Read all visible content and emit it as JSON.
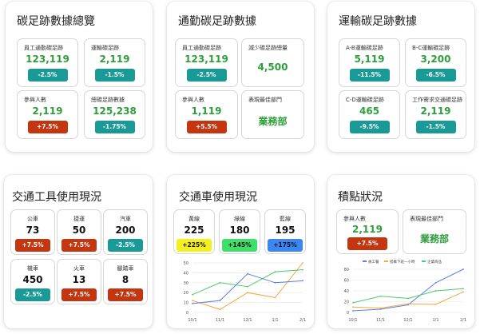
{
  "cards": {
    "overview": {
      "title": "碳足跡數據總覽",
      "cells": [
        {
          "label": "員工通勤碳足跡",
          "value": "123,119",
          "badge": "-2.5%",
          "badge_color": "teal"
        },
        {
          "label": "運輸碳足跡",
          "value": "2,119",
          "badge": "-1.5%",
          "badge_color": "teal"
        },
        {
          "label": "參與人數",
          "value": "2,119",
          "badge": "+7.5%",
          "badge_color": "red"
        },
        {
          "label": "總碳足跡數據",
          "value": "125,238",
          "badge": "-1.75%",
          "badge_color": "teal"
        }
      ]
    },
    "commute": {
      "title": "通勤碳足跡數據",
      "cells": [
        {
          "label": "員工通勤碳足跡",
          "value": "123,119",
          "badge": "-2.5%",
          "badge_color": "teal"
        },
        {
          "label": "減少碳足跡總量",
          "value": "4,500"
        },
        {
          "label": "參與人數",
          "value": "1,119",
          "badge": "+5.5%",
          "badge_color": "red"
        },
        {
          "label": "表現最佳部門",
          "value": "業務部"
        }
      ]
    },
    "transport": {
      "title": "運輸碳足跡數據",
      "cells": [
        {
          "label": "A-B運輸碳足跡",
          "value": "5,119",
          "badge": "-11.5%",
          "badge_color": "teal"
        },
        {
          "label": "B-C運輸碳足跡",
          "value": "3,200",
          "badge": "-6.5%",
          "badge_color": "teal"
        },
        {
          "label": "C-D運輸碳足跡",
          "value": "465",
          "badge": "-9.5%",
          "badge_color": "teal"
        },
        {
          "label": "工作需求交通碳足跡",
          "value": "2,119",
          "badge": "-1.5%",
          "badge_color": "teal"
        }
      ]
    },
    "tools": {
      "title": "交通工具使用現況",
      "cells": [
        {
          "label": "公車",
          "value": "73",
          "badge": "+7.5%",
          "badge_color": "red"
        },
        {
          "label": "捷運",
          "value": "50",
          "badge": "+7.5%",
          "badge_color": "red"
        },
        {
          "label": "汽車",
          "value": "200",
          "badge": "-2.5%",
          "badge_color": "teal"
        },
        {
          "label": "機車",
          "value": "450",
          "badge": "-2.5%",
          "badge_color": "teal"
        },
        {
          "label": "火車",
          "value": "13",
          "badge": "+7.5%",
          "badge_color": "red"
        },
        {
          "label": "腳踏車",
          "value": "8",
          "badge": "+7.5%",
          "badge_color": "red"
        }
      ]
    },
    "shuttle": {
      "title": "交通車使用現況",
      "cells": [
        {
          "label": "黃線",
          "value": "225",
          "badge": "+225%",
          "badge_color": "yellow"
        },
        {
          "label": "綠線",
          "value": "180",
          "badge": "+145%",
          "badge_color": "lime"
        },
        {
          "label": "藍線",
          "value": "195",
          "badge": "+175%",
          "badge_color": "blue"
        }
      ]
    },
    "points": {
      "title": "積點狀況",
      "cells": [
        {
          "label": "參與人數",
          "value": "2,119",
          "badge": "+7.5%",
          "badge_color": "red"
        },
        {
          "label": "表現最佳部門",
          "value": "業務部"
        }
      ]
    }
  },
  "chart_data": [
    {
      "type": "line",
      "x": [
        "10/1",
        "11/1",
        "12/1",
        "1/1",
        "2/1"
      ],
      "ylim": [
        0,
        50
      ],
      "yticks": [
        0,
        10,
        20,
        30,
        40,
        50
      ],
      "series": [
        {
          "color": "#f5a742",
          "values": [
            12,
            3,
            20,
            15,
            50
          ]
        },
        {
          "color": "#4ecb6a",
          "values": [
            18,
            30,
            26,
            41,
            43
          ]
        },
        {
          "color": "#5a7fe0",
          "values": [
            9,
            12,
            39,
            30,
            32
          ]
        }
      ]
    },
    {
      "type": "line",
      "x": [
        "10/1",
        "11/1",
        "12/1",
        "1/1",
        "2/1"
      ],
      "ylim": [
        0,
        80
      ],
      "yticks": [
        0,
        20,
        40,
        60,
        80
      ],
      "legend": [
        "員工餐",
        "搭乘下班一小時",
        "企業商品"
      ],
      "series": [
        {
          "name": "員工餐",
          "color": "#5a7fe0",
          "values": [
            3,
            6,
            14,
            55,
            80
          ]
        },
        {
          "name": "搭乘下班一小時",
          "color": "#f5a742",
          "values": [
            10,
            8,
            16,
            15,
            38
          ]
        },
        {
          "name": "企業商品",
          "color": "#4ecb6a",
          "values": [
            18,
            30,
            26,
            40,
            44
          ]
        }
      ]
    }
  ]
}
